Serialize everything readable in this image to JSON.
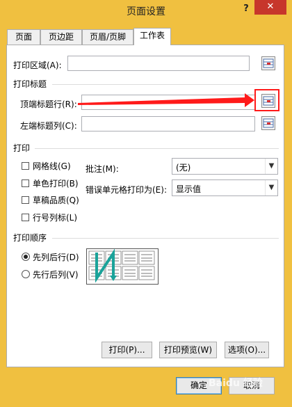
{
  "window": {
    "title": "页面设置",
    "help": "?",
    "close": "✕"
  },
  "tabs": [
    {
      "label": "页面"
    },
    {
      "label": "页边距"
    },
    {
      "label": "页眉/页脚"
    },
    {
      "label": "工作表"
    }
  ],
  "print_area": {
    "label": "打印区域(A):",
    "value": ""
  },
  "print_titles": {
    "heading": "打印标题",
    "rows_label": "顶端标题行(R):",
    "rows_value": "",
    "cols_label": "左端标题列(C):",
    "cols_value": ""
  },
  "print": {
    "heading": "打印",
    "gridlines": {
      "label": "网格线(G)",
      "checked": false
    },
    "black_white": {
      "label": "单色打印(B)",
      "checked": false
    },
    "draft": {
      "label": "草稿品质(Q)",
      "checked": false
    },
    "headings": {
      "label": "行号列标(L)",
      "checked": false
    },
    "comments": {
      "label": "批注(M):",
      "value": "(无)"
    },
    "errors": {
      "label": "错误单元格打印为(E):",
      "value": "显示值"
    }
  },
  "page_order": {
    "heading": "打印顺序",
    "down_then_over": {
      "label": "先列后行(D)",
      "selected": true
    },
    "over_then_down": {
      "label": "先行后列(V)",
      "selected": false
    }
  },
  "panel_buttons": {
    "print": "打印(P)...",
    "preview": "打印预览(W)",
    "options": "选项(O)..."
  },
  "footer": {
    "ok": "确定",
    "cancel": "取消"
  },
  "watermark": "Baidu 经验",
  "colors": {
    "frame": "#f0c040",
    "close": "#c7362b",
    "highlight": "#ff1a1a",
    "order_arrow": "#1aa39a"
  }
}
